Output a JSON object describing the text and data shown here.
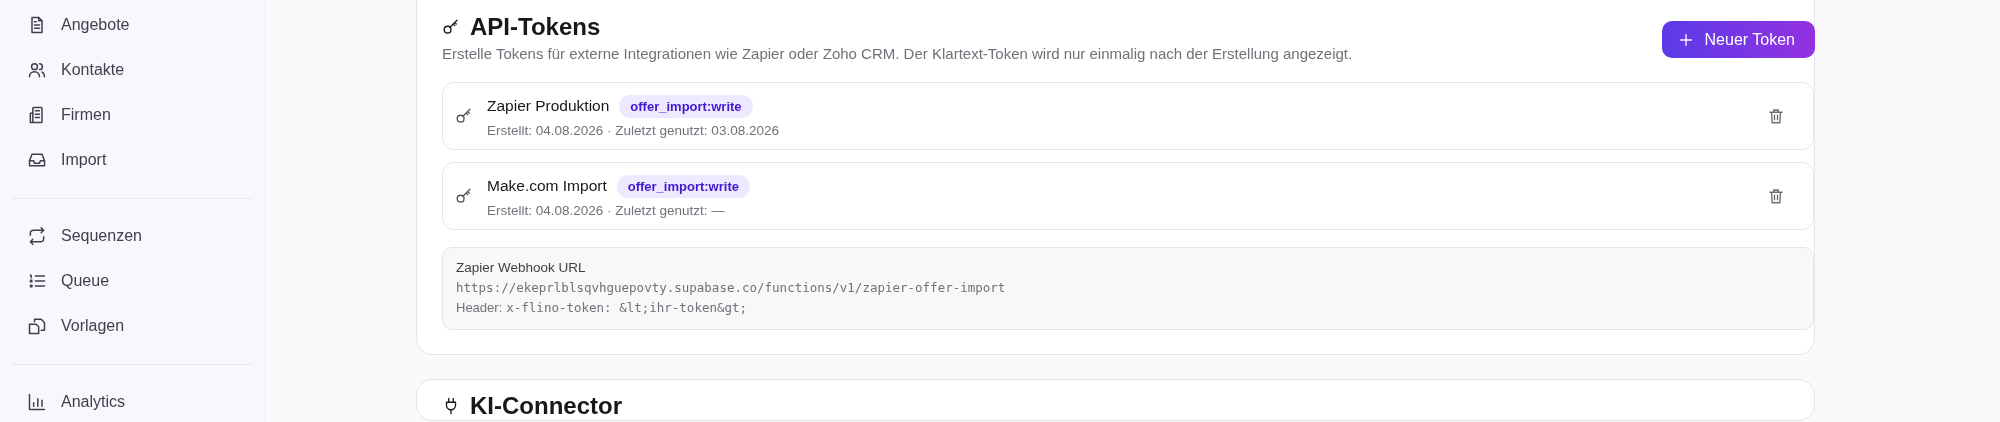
{
  "sidebar": {
    "groups": [
      {
        "items": [
          {
            "label": "Angebote"
          },
          {
            "label": "Kontakte"
          },
          {
            "label": "Firmen"
          },
          {
            "label": "Import"
          }
        ]
      },
      {
        "items": [
          {
            "label": "Sequenzen"
          },
          {
            "label": "Queue"
          },
          {
            "label": "Vorlagen"
          }
        ]
      },
      {
        "items": [
          {
            "label": "Analytics"
          }
        ]
      }
    ]
  },
  "api_tokens": {
    "title": "API-Tokens",
    "description": "Erstelle Tokens für externe Integrationen wie Zapier oder Zoho CRM. Der Klartext-Token wird nur einmalig nach der Erstellung angezeigt.",
    "new_button": "Neuer Token",
    "tokens": [
      {
        "name": "Zapier Produktion",
        "scope": "offer_import:write",
        "meta": "Erstellt: 04.08.2026 · Zuletzt genutzt: 03.08.2026"
      },
      {
        "name": "Make.com Import",
        "scope": "offer_import:write",
        "meta": "Erstellt: 04.08.2026 · Zuletzt genutzt: —"
      }
    ],
    "webhook": {
      "label": "Zapier Webhook URL",
      "url": "https://ekeprlblsqvhguepovty.supabase.co/functions/v1/zapier-offer-import",
      "header_label": "Header:",
      "header_value": "x-flino-token: &lt;ihr-token&gt;"
    }
  },
  "ki_connector": {
    "title": "KI-Connector"
  }
}
